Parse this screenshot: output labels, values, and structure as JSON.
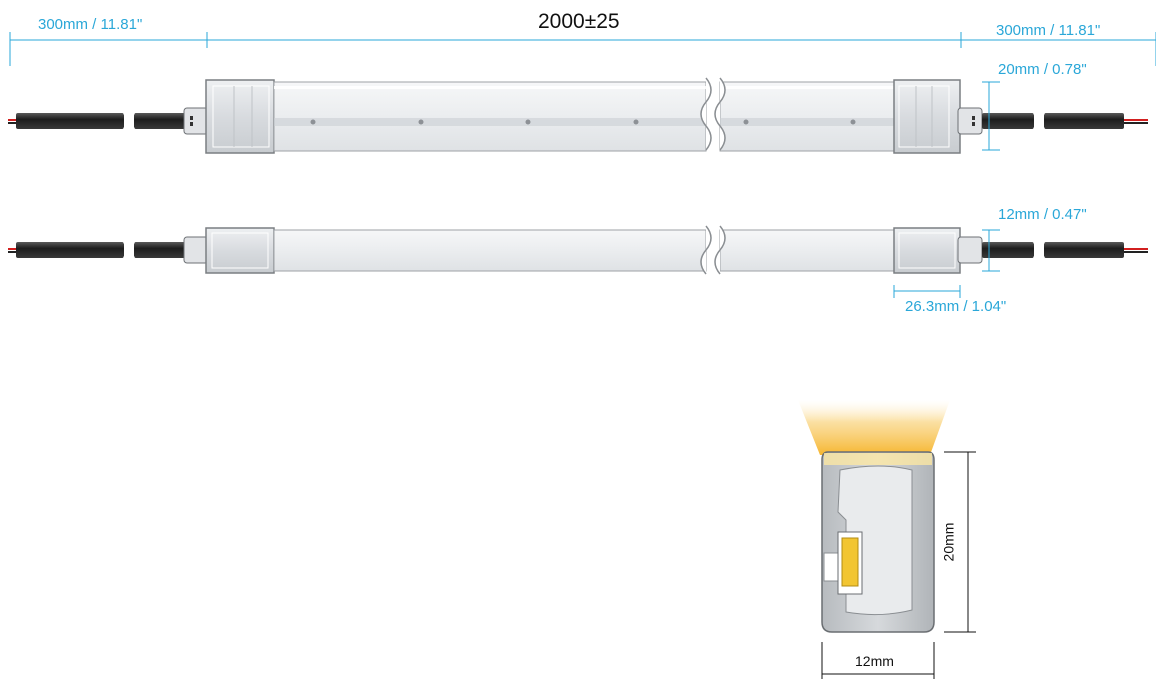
{
  "labels": {
    "total_length": "2000±25",
    "cable_left": "300mm / 11.81\"",
    "cable_right": "300mm / 11.81\"",
    "height_side": "20mm / 0.78\"",
    "width_top": "12mm / 0.47\"",
    "cap_length": "26.3mm / 1.04\"",
    "section_height": "20mm",
    "section_width": "12mm"
  },
  "colors": {
    "dimension": "#2aa7d8",
    "tube_fill": "#eef0f2",
    "end_cap": "#d9dce0",
    "cable": "#2b2b2b",
    "wire_red": "#d21f1f",
    "led": "#f2c531",
    "glow": "#f6c24a",
    "profile": "#a8acb0"
  }
}
